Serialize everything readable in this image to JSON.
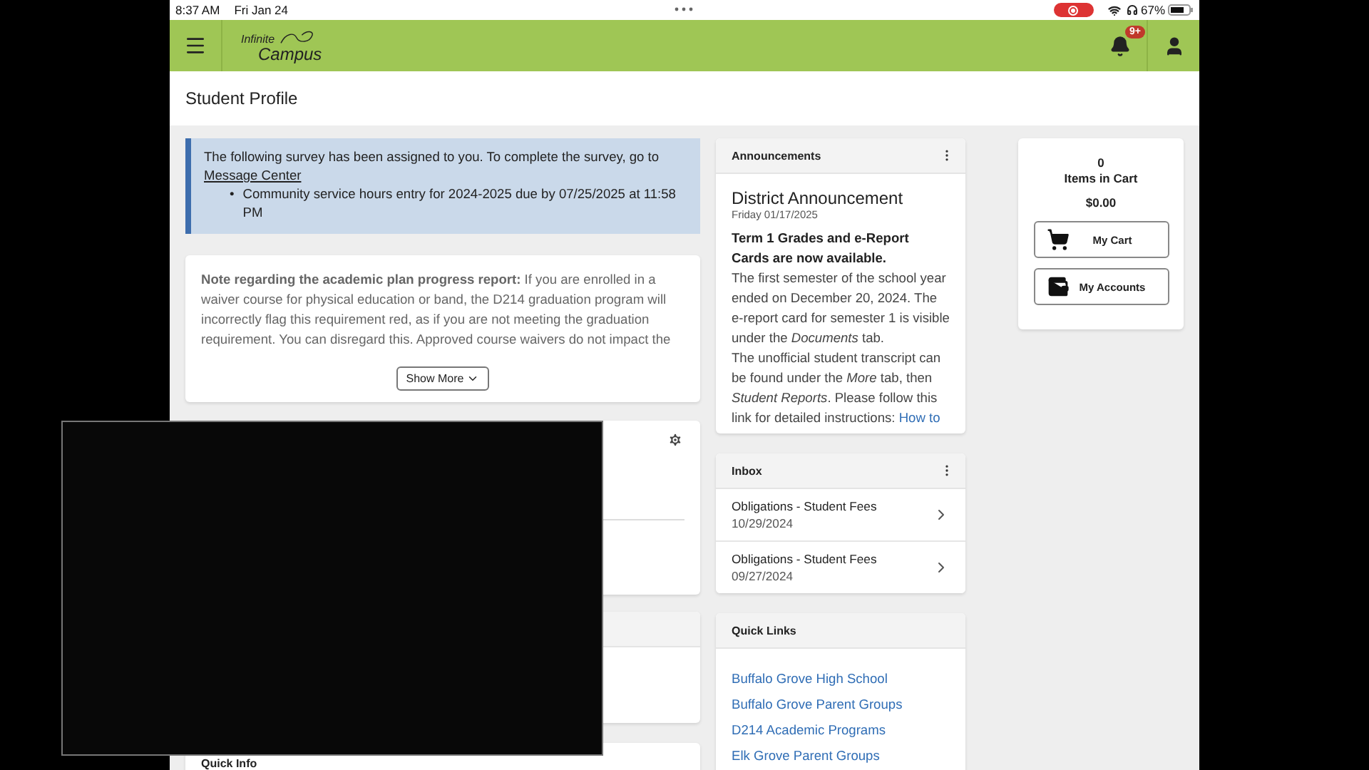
{
  "status_bar": {
    "time": "8:37 AM",
    "date": "Fri Jan 24",
    "battery": "67%"
  },
  "header": {
    "logo_top": "Infinite",
    "logo_bottom": "Campus",
    "notification_badge": "9+"
  },
  "page_title": "Student Profile",
  "survey": {
    "text": "The following survey has been assigned to you. To complete the survey, go to",
    "link": "Message Center",
    "items": [
      {
        "marker": "•",
        "text": "Community service hours entry for 2024-2025 due by 07/25/2025 at 11:58 PM"
      }
    ]
  },
  "note": {
    "text": "**Note regarding the academic plan progress report:** If you are enrolled in a waiver course for physical education or band, the D214 graduation program will incorrectly flag this requirement red, as if you are not meeting the graduation requirement. You can disregard this. Approved course waivers do not impact the",
    "button": "Show More"
  },
  "quick_info": {
    "title": "Quick Info"
  },
  "announcements": {
    "title": "Announcements",
    "heading": "District Announcement",
    "date": "Friday 01/17/2025",
    "lead": "Term 1 Grades and e-Report Cards are now available.",
    "body": "The first semester of the school year ended on December 20, 2024. The e-report card for semester 1 is visible under the *Documents* tab.",
    "body2": "The unofficial student transcript can be found under the *More* tab, then *Student Reports*. Please follow this link for detailed instructions:",
    "link": "How to"
  },
  "inbox": {
    "title": "Inbox",
    "items": [
      {
        "title": "Obligations - Student Fees",
        "date": "10/29/2024"
      },
      {
        "title": "Obligations - Student Fees",
        "date": "09/27/2024"
      }
    ]
  },
  "quick_links": {
    "title": "Quick Links",
    "items": [
      "Buffalo Grove High School",
      "Buffalo Grove Parent Groups",
      "D214 Academic Programs",
      "Elk Grove Parent Groups"
    ]
  },
  "cart": {
    "count": "0",
    "label": "Items in Cart",
    "total": "$0.00",
    "buttons": [
      {
        "kind": "cart",
        "label": "My Cart"
      },
      {
        "kind": "accounts",
        "label": "My Accounts"
      }
    ]
  }
}
